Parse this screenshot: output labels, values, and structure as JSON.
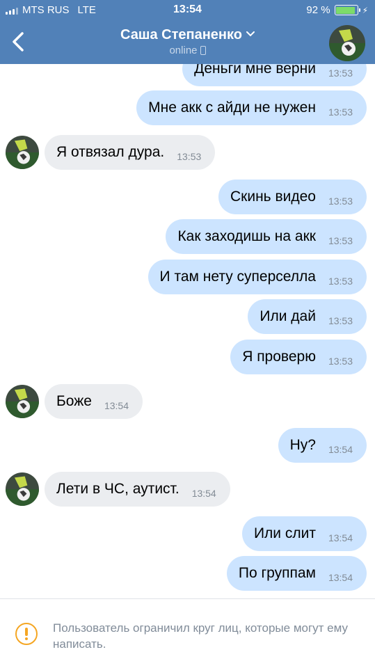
{
  "status_bar": {
    "carrier": "MTS RUS",
    "network": "LTE",
    "time": "13:54",
    "battery": "92 %",
    "battery_level": 0.92
  },
  "header": {
    "back_icon": "chevron-left-icon",
    "contact_name": "Саша Степаненко",
    "status": "online",
    "device_icon": "phone-icon",
    "dropdown_icon": "chevron-down-icon"
  },
  "messages": [
    {
      "dir": "out",
      "text": "Деньги мне верни",
      "time": "13:53"
    },
    {
      "dir": "out",
      "text": "Мне акк с айди не нужен",
      "time": "13:53"
    },
    {
      "dir": "in",
      "text": "Я отвязал дура.",
      "time": "13:53"
    },
    {
      "dir": "out",
      "text": "Скинь видео",
      "time": "13:53"
    },
    {
      "dir": "out",
      "text": "Как заходишь на акк",
      "time": "13:53"
    },
    {
      "dir": "out",
      "text": "И там нету суперселла",
      "time": "13:53"
    },
    {
      "dir": "out",
      "text": "Или дай",
      "time": "13:53"
    },
    {
      "dir": "out",
      "text": "Я проверю",
      "time": "13:53"
    },
    {
      "dir": "in",
      "text": "Боже",
      "time": "13:54"
    },
    {
      "dir": "out",
      "text": "Ну?",
      "time": "13:54"
    },
    {
      "dir": "in",
      "text": "Лети в ЧС, аутист.",
      "time": "13:54"
    },
    {
      "dir": "out",
      "text": "Или слит",
      "time": "13:54"
    },
    {
      "dir": "out",
      "text": "По группам",
      "time": "13:54"
    }
  ],
  "notice": {
    "icon": "warning-icon",
    "text": "Пользователь ограничил круг лиц, которые могут ему написать."
  },
  "colors": {
    "header_bg": "#5181b8",
    "outgoing_bubble": "#cce4ff",
    "incoming_bubble": "#ebedf0",
    "warning": "#f5a623",
    "battery": "#7ddc6a"
  }
}
